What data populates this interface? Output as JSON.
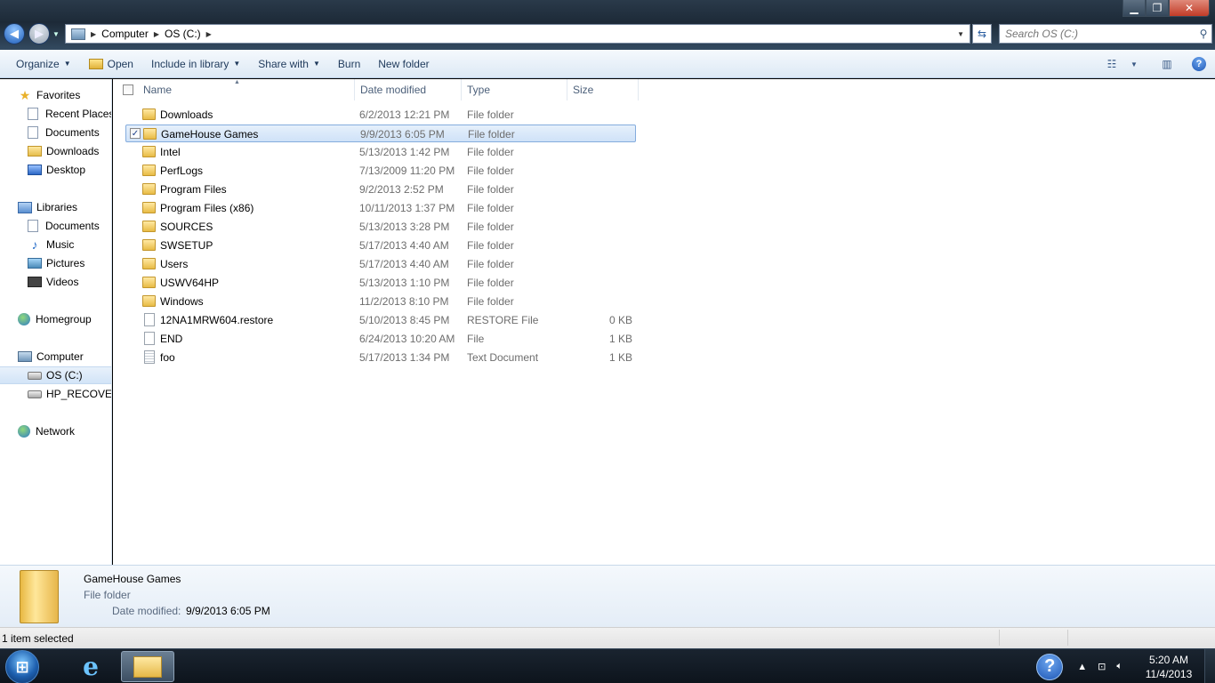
{
  "window": {
    "min_glyph": "▁",
    "max_glyph": "❐",
    "close_glyph": "✕"
  },
  "address": {
    "crumbs": [
      "Computer",
      "OS (C:)"
    ],
    "search_placeholder": "Search OS (C:)"
  },
  "toolbar": {
    "organize": "Organize",
    "open": "Open",
    "include_in_library": "Include in library",
    "share_with": "Share with",
    "burn": "Burn",
    "new_folder": "New folder"
  },
  "nav": {
    "favorites": "Favorites",
    "recent_places": "Recent Places",
    "documents": "Documents",
    "downloads": "Downloads",
    "desktop": "Desktop",
    "libraries": "Libraries",
    "lib_documents": "Documents",
    "music": "Music",
    "pictures": "Pictures",
    "videos": "Videos",
    "homegroup": "Homegroup",
    "computer": "Computer",
    "os_c": "OS (C:)",
    "hp_recovery": "HP_RECOVERY",
    "network": "Network"
  },
  "columns": {
    "name": "Name",
    "date_modified": "Date modified",
    "type": "Type",
    "size": "Size"
  },
  "files": [
    {
      "name": "Downloads",
      "date": "6/2/2013 12:21 PM",
      "type": "File folder",
      "size": "",
      "kind": "folder"
    },
    {
      "name": "GameHouse Games",
      "date": "9/9/2013 6:05 PM",
      "type": "File folder",
      "size": "",
      "kind": "folder",
      "selected": true
    },
    {
      "name": "Intel",
      "date": "5/13/2013 1:42 PM",
      "type": "File folder",
      "size": "",
      "kind": "folder"
    },
    {
      "name": "PerfLogs",
      "date": "7/13/2009 11:20 PM",
      "type": "File folder",
      "size": "",
      "kind": "folder"
    },
    {
      "name": "Program Files",
      "date": "9/2/2013 2:52 PM",
      "type": "File folder",
      "size": "",
      "kind": "folder"
    },
    {
      "name": "Program Files (x86)",
      "date": "10/11/2013 1:37 PM",
      "type": "File folder",
      "size": "",
      "kind": "folder"
    },
    {
      "name": "SOURCES",
      "date": "5/13/2013 3:28 PM",
      "type": "File folder",
      "size": "",
      "kind": "folder"
    },
    {
      "name": "SWSETUP",
      "date": "5/17/2013 4:40 AM",
      "type": "File folder",
      "size": "",
      "kind": "folder"
    },
    {
      "name": "Users",
      "date": "5/17/2013 4:40 AM",
      "type": "File folder",
      "size": "",
      "kind": "folder"
    },
    {
      "name": "USWV64HP",
      "date": "5/13/2013 1:10 PM",
      "type": "File folder",
      "size": "",
      "kind": "folder"
    },
    {
      "name": "Windows",
      "date": "11/2/2013 8:10 PM",
      "type": "File folder",
      "size": "",
      "kind": "folder"
    },
    {
      "name": "12NA1MRW604.restore",
      "date": "5/10/2013 8:45 PM",
      "type": "RESTORE File",
      "size": "0 KB",
      "kind": "file"
    },
    {
      "name": "END",
      "date": "6/24/2013 10:20 AM",
      "type": "File",
      "size": "1 KB",
      "kind": "file"
    },
    {
      "name": "foo",
      "date": "5/17/2013 1:34 PM",
      "type": "Text Document",
      "size": "1 KB",
      "kind": "text"
    }
  ],
  "details": {
    "name": "GameHouse Games",
    "type": "File folder",
    "date_label": "Date modified:",
    "date_value": "9/9/2013 6:05 PM"
  },
  "status": {
    "text": "1 item selected"
  },
  "taskbar": {
    "clock_time": "5:20 AM",
    "clock_date": "11/4/2013"
  }
}
